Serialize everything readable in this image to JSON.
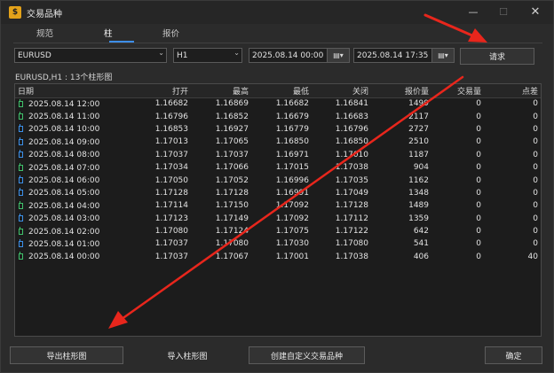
{
  "window": {
    "title": "交易品种",
    "icon_letter": "$"
  },
  "tabs": [
    {
      "label": "规范"
    },
    {
      "label": "柱"
    },
    {
      "label": "报价"
    }
  ],
  "symbol_select": {
    "value": "EURUSD"
  },
  "timeframe_select": {
    "value": "H1"
  },
  "date_from": {
    "value": "2025.08.14 00:00"
  },
  "date_to": {
    "value": "2025.08.14 17:35"
  },
  "request_button": {
    "label": "请求"
  },
  "info": {
    "text": "EURUSD,H1 : 13个柱形图"
  },
  "table": {
    "columns": [
      "日期",
      "打开",
      "最高",
      "最低",
      "关闭",
      "报价量",
      "交易量",
      "点差"
    ],
    "rows": [
      {
        "icon_color": "#3fc06a",
        "cells": [
          "2025.08.14 12:00",
          "1.16682",
          "1.16869",
          "1.16682",
          "1.16841",
          "1499",
          "0",
          "0"
        ]
      },
      {
        "icon_color": "#3fc06a",
        "cells": [
          "2025.08.14 11:00",
          "1.16796",
          "1.16852",
          "1.16679",
          "1.16683",
          "2117",
          "0",
          "0"
        ]
      },
      {
        "icon_color": "#3b8fe8",
        "cells": [
          "2025.08.14 10:00",
          "1.16853",
          "1.16927",
          "1.16779",
          "1.16796",
          "2727",
          "0",
          "0"
        ]
      },
      {
        "icon_color": "#3b8fe8",
        "cells": [
          "2025.08.14 09:00",
          "1.17013",
          "1.17065",
          "1.16850",
          "1.16850",
          "2510",
          "0",
          "0"
        ]
      },
      {
        "icon_color": "#3b8fe8",
        "cells": [
          "2025.08.14 08:00",
          "1.17037",
          "1.17037",
          "1.16971",
          "1.17010",
          "1187",
          "0",
          "0"
        ]
      },
      {
        "icon_color": "#3fc06a",
        "cells": [
          "2025.08.14 07:00",
          "1.17034",
          "1.17066",
          "1.17015",
          "1.17038",
          "904",
          "0",
          "0"
        ]
      },
      {
        "icon_color": "#3b8fe8",
        "cells": [
          "2025.08.14 06:00",
          "1.17050",
          "1.17052",
          "1.16996",
          "1.17035",
          "1162",
          "0",
          "0"
        ]
      },
      {
        "icon_color": "#3b8fe8",
        "cells": [
          "2025.08.14 05:00",
          "1.17128",
          "1.17128",
          "1.16991",
          "1.17049",
          "1348",
          "0",
          "0"
        ]
      },
      {
        "icon_color": "#3fc06a",
        "cells": [
          "2025.08.14 04:00",
          "1.17114",
          "1.17150",
          "1.17092",
          "1.17128",
          "1489",
          "0",
          "0"
        ]
      },
      {
        "icon_color": "#3b8fe8",
        "cells": [
          "2025.08.14 03:00",
          "1.17123",
          "1.17149",
          "1.17092",
          "1.17112",
          "1359",
          "0",
          "0"
        ]
      },
      {
        "icon_color": "#3fc06a",
        "cells": [
          "2025.08.14 02:00",
          "1.17080",
          "1.17124",
          "1.17075",
          "1.17122",
          "642",
          "0",
          "0"
        ]
      },
      {
        "icon_color": "#3b8fe8",
        "cells": [
          "2025.08.14 01:00",
          "1.17037",
          "1.17080",
          "1.17030",
          "1.17080",
          "541",
          "0",
          "0"
        ]
      },
      {
        "icon_color": "#3fc06a",
        "cells": [
          "2025.08.14 00:00",
          "1.17037",
          "1.17067",
          "1.17001",
          "1.17038",
          "406",
          "0",
          "40"
        ]
      }
    ]
  },
  "footer": {
    "export_label": "导出柱形图",
    "import_label": "导入柱形图",
    "create_label": "创建自定义交易品种",
    "ok_label": "确定"
  },
  "annotation_colors": {
    "arrow": "#e8261c"
  }
}
